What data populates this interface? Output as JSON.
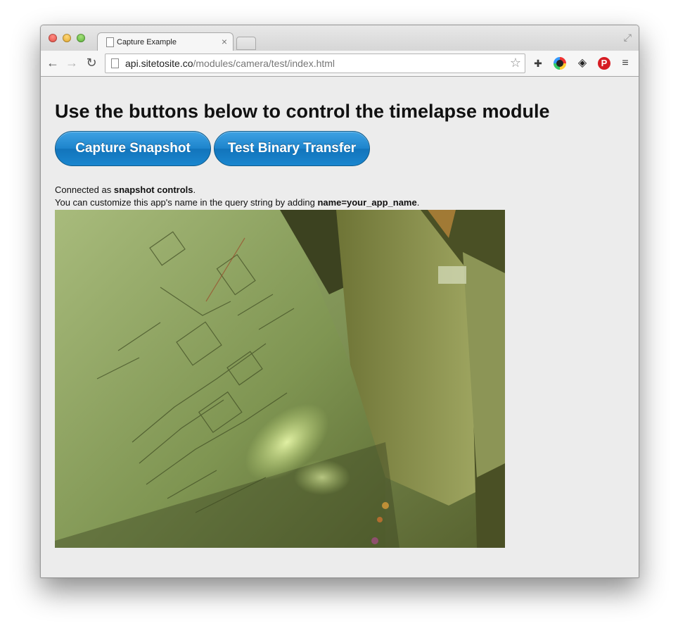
{
  "browser": {
    "tab_title": "Capture Example",
    "tab_close": "×",
    "url_host": "api.sitetosite.co",
    "url_path": "/modules/camera/test/index.html",
    "nav": {
      "back": "←",
      "forward": "→",
      "reload": "↻"
    },
    "star": "☆",
    "menu": "≡",
    "icons": [
      "document-icon",
      "star-icon",
      "extension-icon",
      "color-eye-icon",
      "layers-icon",
      "pinterest-icon",
      "menu-icon",
      "fullscreen-icon"
    ]
  },
  "page": {
    "heading": "Use the buttons below to control the timelapse module",
    "buttons": {
      "capture": "Capture Snapshot",
      "binary": "Test Binary Transfer"
    },
    "status": {
      "connected_prefix": "Connected as ",
      "connected_name": "snapshot controls",
      "connected_suffix": ".",
      "customize_prefix": "You can customize this app's name in the query string by adding ",
      "customize_param": "name=your_app_name",
      "customize_suffix": "."
    }
  },
  "colors": {
    "button_blue": "#1d84cc",
    "page_bg": "#ececec"
  }
}
